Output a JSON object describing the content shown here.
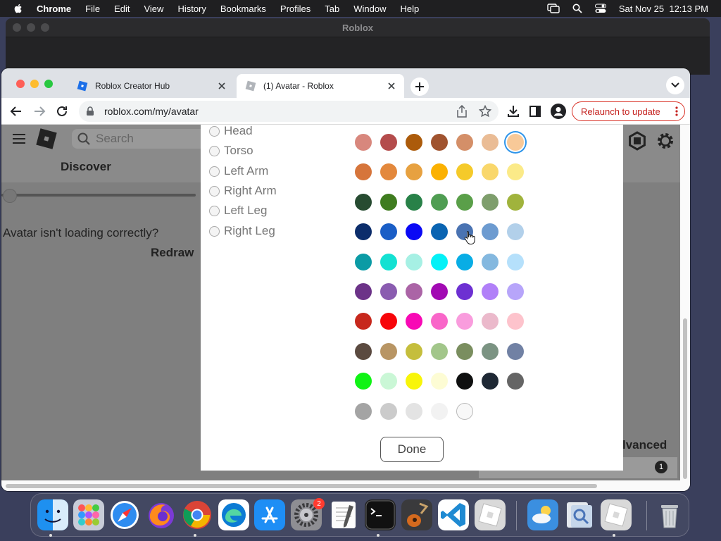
{
  "menubar": {
    "app": "Chrome",
    "items": [
      "File",
      "Edit",
      "View",
      "History",
      "Bookmarks",
      "Profiles",
      "Tab",
      "Window",
      "Help"
    ],
    "datetime": "Sat Nov 25  12:13 PM"
  },
  "background_window": {
    "title": "Roblox"
  },
  "tabs": [
    {
      "title": "Roblox Creator Hub",
      "active": false
    },
    {
      "title": "(1) Avatar - Roblox",
      "active": true
    }
  ],
  "address_bar": {
    "url": "roblox.com/my/avatar"
  },
  "relaunch_label": "Relaunch to update",
  "page": {
    "search_placeholder": "Search",
    "discover": "Discover",
    "avatar_message": "Avatar isn't loading correctly?",
    "redraw": "Redraw",
    "advanced_partial": "lvanced",
    "notification_count": "1"
  },
  "modal": {
    "body_parts": [
      "Head",
      "Torso",
      "Left Arm",
      "Right Arm",
      "Left Leg",
      "Right Leg"
    ],
    "done_label": "Done",
    "selected_color": "#f8c998",
    "hover_color": "#4a73b2",
    "palette": [
      [
        "#d8877d",
        "#b44c4c",
        "#ac5b0b",
        "#a0532f",
        "#d48f68",
        "#eabc95",
        "#f8c998"
      ],
      [
        "#d6753b",
        "#e3883c",
        "#e7a140",
        "#fbb102",
        "#f5ca2a",
        "#f9d76b",
        "#fbea88"
      ],
      [
        "#274b31",
        "#3f7c1f",
        "#288148",
        "#4f9d52",
        "#5a9f49",
        "#7e9e6c",
        "#a0b33c"
      ],
      [
        "#0c2d6b",
        "#1a5ec6",
        "#0a09f5",
        "#0a64b2",
        "#4a73b2",
        "#6d9bd0",
        "#b2d0ea"
      ],
      [
        "#0b9ba5",
        "#14e1d2",
        "#a6f0e4",
        "#04f1f7",
        "#08ade5",
        "#84b8df",
        "#b5e0fb"
      ],
      [
        "#6c3388",
        "#8a5cb0",
        "#ab64a6",
        "#a20ab3",
        "#6d30d2",
        "#b180f8",
        "#b7a5fa"
      ],
      [
        "#c7281d",
        "#f7050a",
        "#f809b5",
        "#f966c9",
        "#f99cdd",
        "#ebb9cb",
        "#fdc3cc"
      ],
      [
        "#5b4a40",
        "#b89564",
        "#c5be3c",
        "#a2c68a",
        "#7a8e5f",
        "#7b9382",
        "#7181a4"
      ],
      [
        "#10f315",
        "#caf7d6",
        "#f8f50a",
        "#fdfcd4",
        "#0f1010",
        "#1e2834",
        "#656565"
      ],
      [
        "#a4a4a4",
        "#cbcbcb",
        "#e3e3e3",
        "#f2f2f2",
        "#f8f8f8"
      ]
    ]
  },
  "dock": {
    "apps": [
      "finder-icon",
      "launchpad-icon",
      "safari-icon",
      "firefox-icon",
      "chrome-icon",
      "edge-icon",
      "app-store-icon",
      "system-settings-icon",
      "textedit-icon",
      "terminal-icon",
      "garageband-icon",
      "vscode-icon",
      "roblox-icon",
      "weather-icon",
      "preview-icon",
      "roblox-studio-icon",
      "trash-icon"
    ],
    "settings_badge": "2"
  }
}
